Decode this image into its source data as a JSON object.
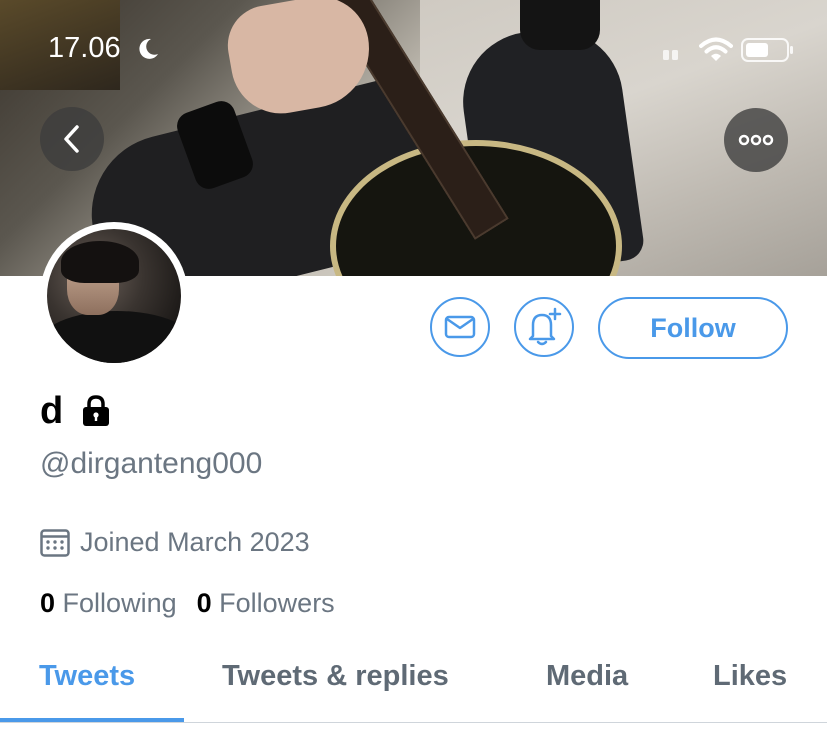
{
  "status_bar": {
    "time": "17.06",
    "icons": [
      "moon-icon",
      "signal-icon",
      "wifi-icon",
      "battery-icon"
    ]
  },
  "header": {
    "back_icon": "chevron-left-icon",
    "more_icon": "ellipsis-icon"
  },
  "profile": {
    "display_name": "d",
    "protected_icon": "lock-icon",
    "handle": "@dirganteng000",
    "joined": "Joined March 2023",
    "following_count": "0",
    "following_label": "Following",
    "followers_count": "0",
    "followers_label": "Followers"
  },
  "actions": {
    "message_icon": "envelope-icon",
    "notify_icon": "bell-plus-icon",
    "follow_label": "Follow"
  },
  "tabs": [
    {
      "label": "Tweets",
      "active": true
    },
    {
      "label": "Tweets & replies",
      "active": false
    },
    {
      "label": "Media",
      "active": false
    },
    {
      "label": "Likes",
      "active": false
    }
  ],
  "colors": {
    "accent": "#4a99e9",
    "secondary_text": "#6b7682",
    "primary_text": "#000000"
  }
}
